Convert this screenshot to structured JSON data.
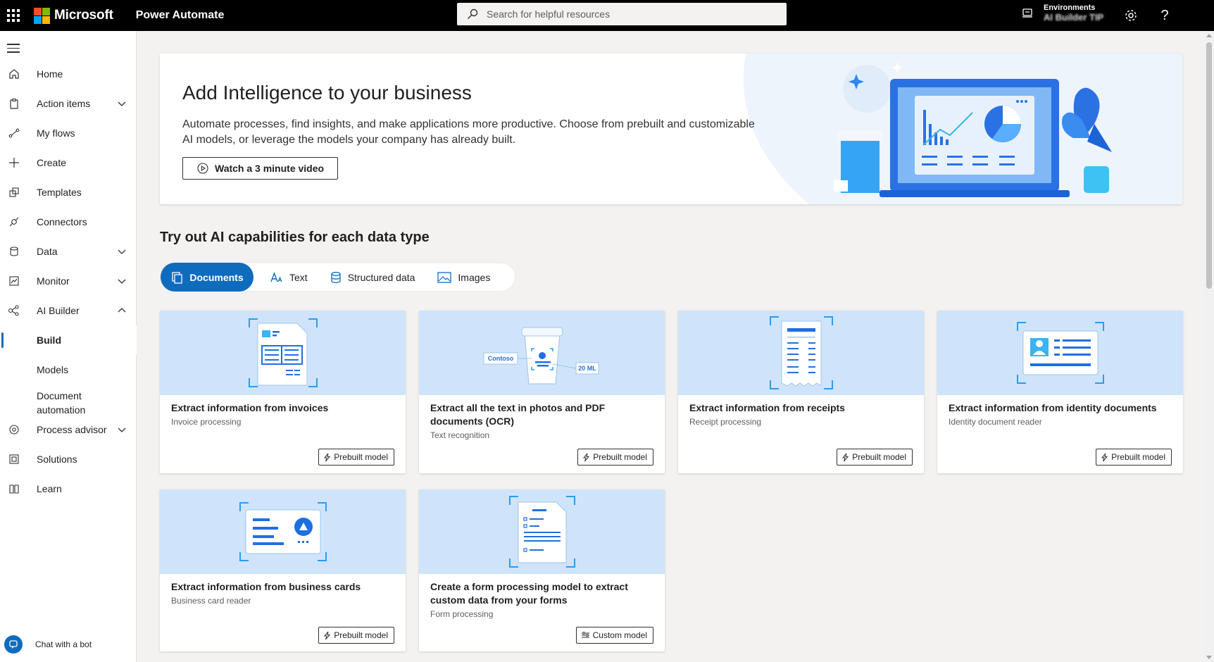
{
  "topbar": {
    "brand": "Microsoft",
    "app_name": "Power Automate",
    "search_placeholder": "Search for helpful resources",
    "env_label": "Environments",
    "env_value": "AI Builder TIP",
    "icons": [
      "app-launcher-icon",
      "environment-icon",
      "settings-icon",
      "help-icon"
    ],
    "help_glyph": "?"
  },
  "sidebar": {
    "items": [
      {
        "label": "Home",
        "icon": "home-icon"
      },
      {
        "label": "Action items",
        "icon": "clipboard-icon",
        "expandable": true
      },
      {
        "label": "My flows",
        "icon": "flow-icon"
      },
      {
        "label": "Create",
        "icon": "plus-icon"
      },
      {
        "label": "Templates",
        "icon": "templates-icon"
      },
      {
        "label": "Connectors",
        "icon": "connector-icon"
      },
      {
        "label": "Data",
        "icon": "database-icon",
        "expandable": true
      },
      {
        "label": "Monitor",
        "icon": "monitor-icon",
        "expandable": true
      },
      {
        "label": "AI Builder",
        "icon": "ai-builder-icon",
        "expanded": true
      },
      {
        "label": "Build",
        "active": true
      },
      {
        "label": "Models"
      },
      {
        "label": "Document automation"
      },
      {
        "label": "Process advisor",
        "icon": "process-advisor-icon",
        "expandable": true
      },
      {
        "label": "Solutions",
        "icon": "solutions-icon"
      },
      {
        "label": "Learn",
        "icon": "book-icon"
      }
    ],
    "chat_label": "Chat with a bot"
  },
  "hero": {
    "title": "Add Intelligence to your business",
    "description": "Automate processes, find insights, and make applications more productive. Choose from prebuilt and customizable AI models, or leverage the models your company has already built.",
    "button_label": "Watch a 3 minute video"
  },
  "section_title": "Try out AI capabilities for each data type",
  "tabs": [
    {
      "label": "Documents",
      "active": true,
      "icon": "documents-icon"
    },
    {
      "label": "Text",
      "icon": "text-icon"
    },
    {
      "label": "Structured data",
      "icon": "database-icon"
    },
    {
      "label": "Images",
      "icon": "image-icon"
    }
  ],
  "cards": [
    {
      "title": "Extract information from invoices",
      "subtitle": "Invoice processing",
      "button": "Prebuilt model"
    },
    {
      "title": "Extract all the text in photos and PDF documents (OCR)",
      "subtitle": "Text recognition",
      "button": "Prebuilt model",
      "art_labels": [
        "Contoso",
        "20 ML"
      ]
    },
    {
      "title": "Extract information from receipts",
      "subtitle": "Receipt processing",
      "button": "Prebuilt model"
    },
    {
      "title": "Extract information from identity documents",
      "subtitle": "Identity document reader",
      "button": "Prebuilt model"
    },
    {
      "title": "Extract information from business cards",
      "subtitle": "Business card reader",
      "button": "Prebuilt model"
    },
    {
      "title": "Create a form processing model to extract custom data from your forms",
      "subtitle": "Form processing",
      "button": "Custom model"
    }
  ],
  "colors": {
    "accent": "#0f6cbd",
    "card_art_bg": "#cfe4fa",
    "topbar_bg": "#000000"
  }
}
